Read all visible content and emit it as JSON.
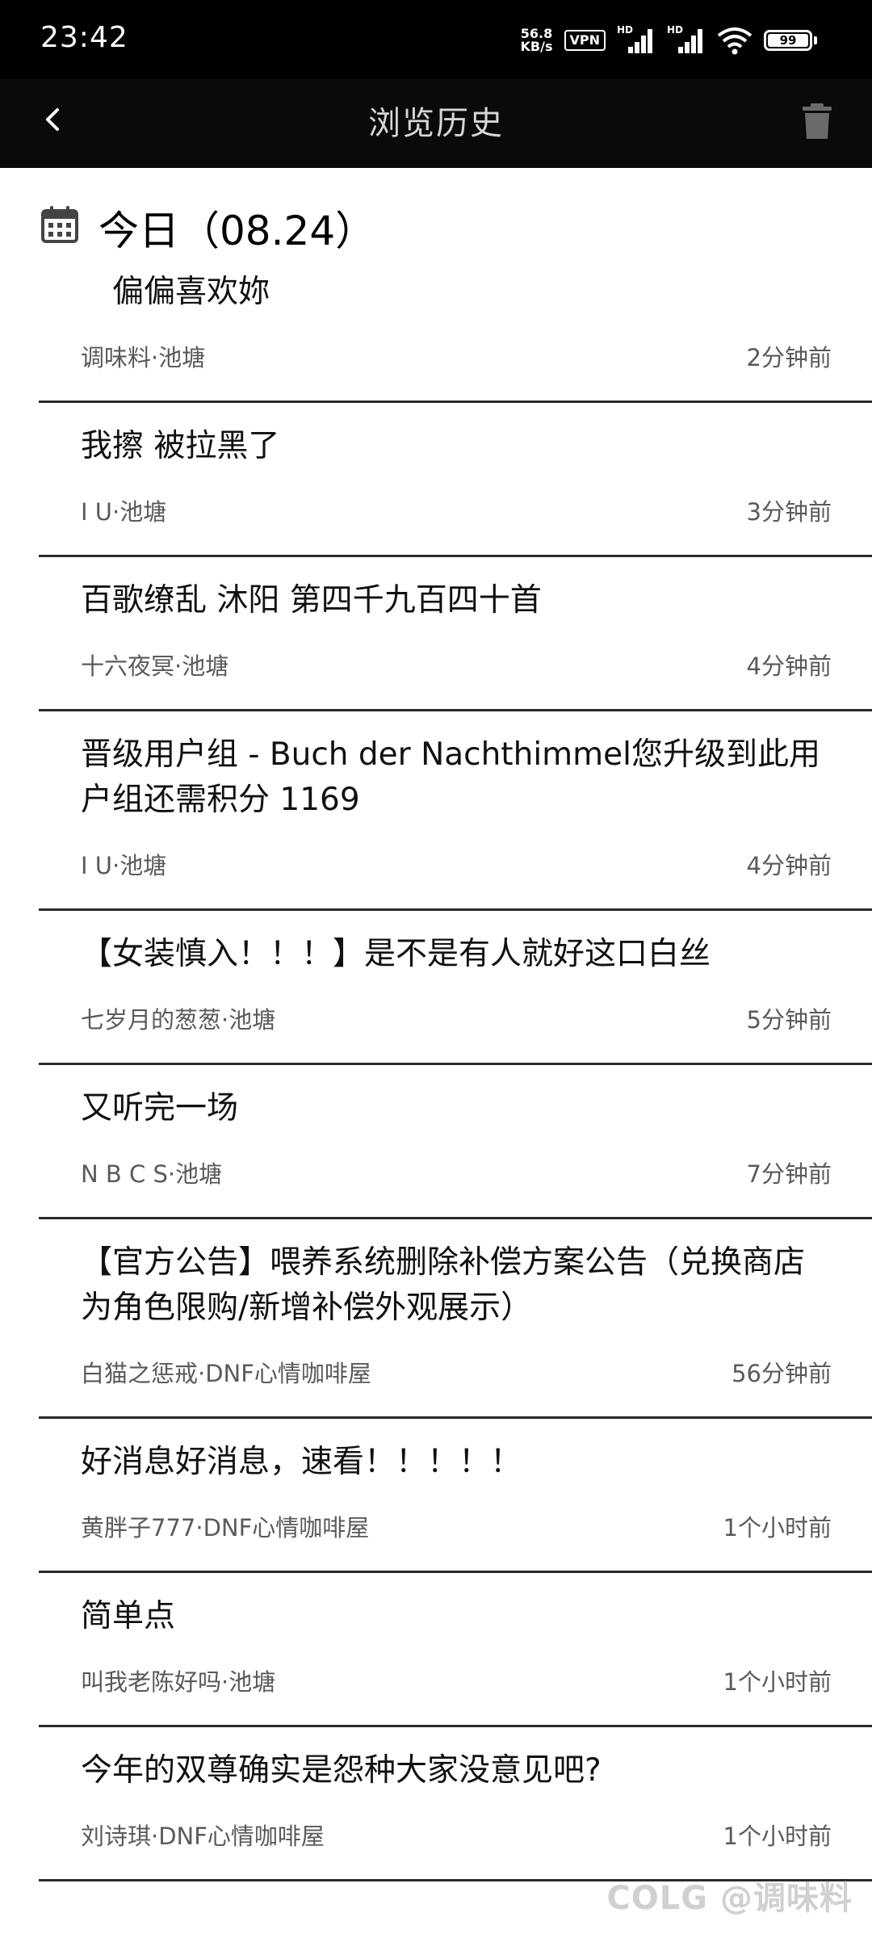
{
  "status_bar": {
    "time": "23:42",
    "net_speed_value": "56.8",
    "net_speed_unit": "KB/s",
    "vpn": "VPN",
    "signal1_label": "HD",
    "signal2_label": "HD",
    "battery": "99"
  },
  "nav": {
    "title": "浏览历史"
  },
  "date_header": {
    "label": "今日（08.24）"
  },
  "history": [
    {
      "title": "　偏偏喜欢妳",
      "source": "调味料·池塘",
      "time": "2分钟前"
    },
    {
      "title": "我擦 被拉黑了",
      "source": "I U·池塘",
      "time": "3分钟前"
    },
    {
      "title": "百歌缭乱 沐阳 第四千九百四十首",
      "source": "十六夜冥·池塘",
      "time": "4分钟前"
    },
    {
      "title": "晋级用户组 - Buch der Nachthimmel您升级到此用户组还需积分 1169",
      "source": "I U·池塘",
      "time": "4分钟前"
    },
    {
      "title": "【女装慎入！！！】是不是有人就好这口白丝",
      "source": "七岁月的葱葱·池塘",
      "time": "5分钟前"
    },
    {
      "title": "又听完一场",
      "source": "N B C S·池塘",
      "time": "7分钟前"
    },
    {
      "title": "【官方公告】喂养系统删除补偿方案公告（兑换商店为角色限购/新增补偿外观展示）",
      "source": "白猫之惩戒·DNF心情咖啡屋",
      "time": "56分钟前"
    },
    {
      "title": "好消息好消息，速看！！！！！",
      "source": "黄胖子777·DNF心情咖啡屋",
      "time": "1个小时前"
    },
    {
      "title": "简单点",
      "source": "叫我老陈好吗·池塘",
      "time": "1个小时前"
    },
    {
      "title": "今年的双尊确实是怨种大家没意见吧?",
      "source": "刘诗琪·DNF心情咖啡屋",
      "time": "1个小时前"
    }
  ],
  "watermark": "COLG @调味料"
}
